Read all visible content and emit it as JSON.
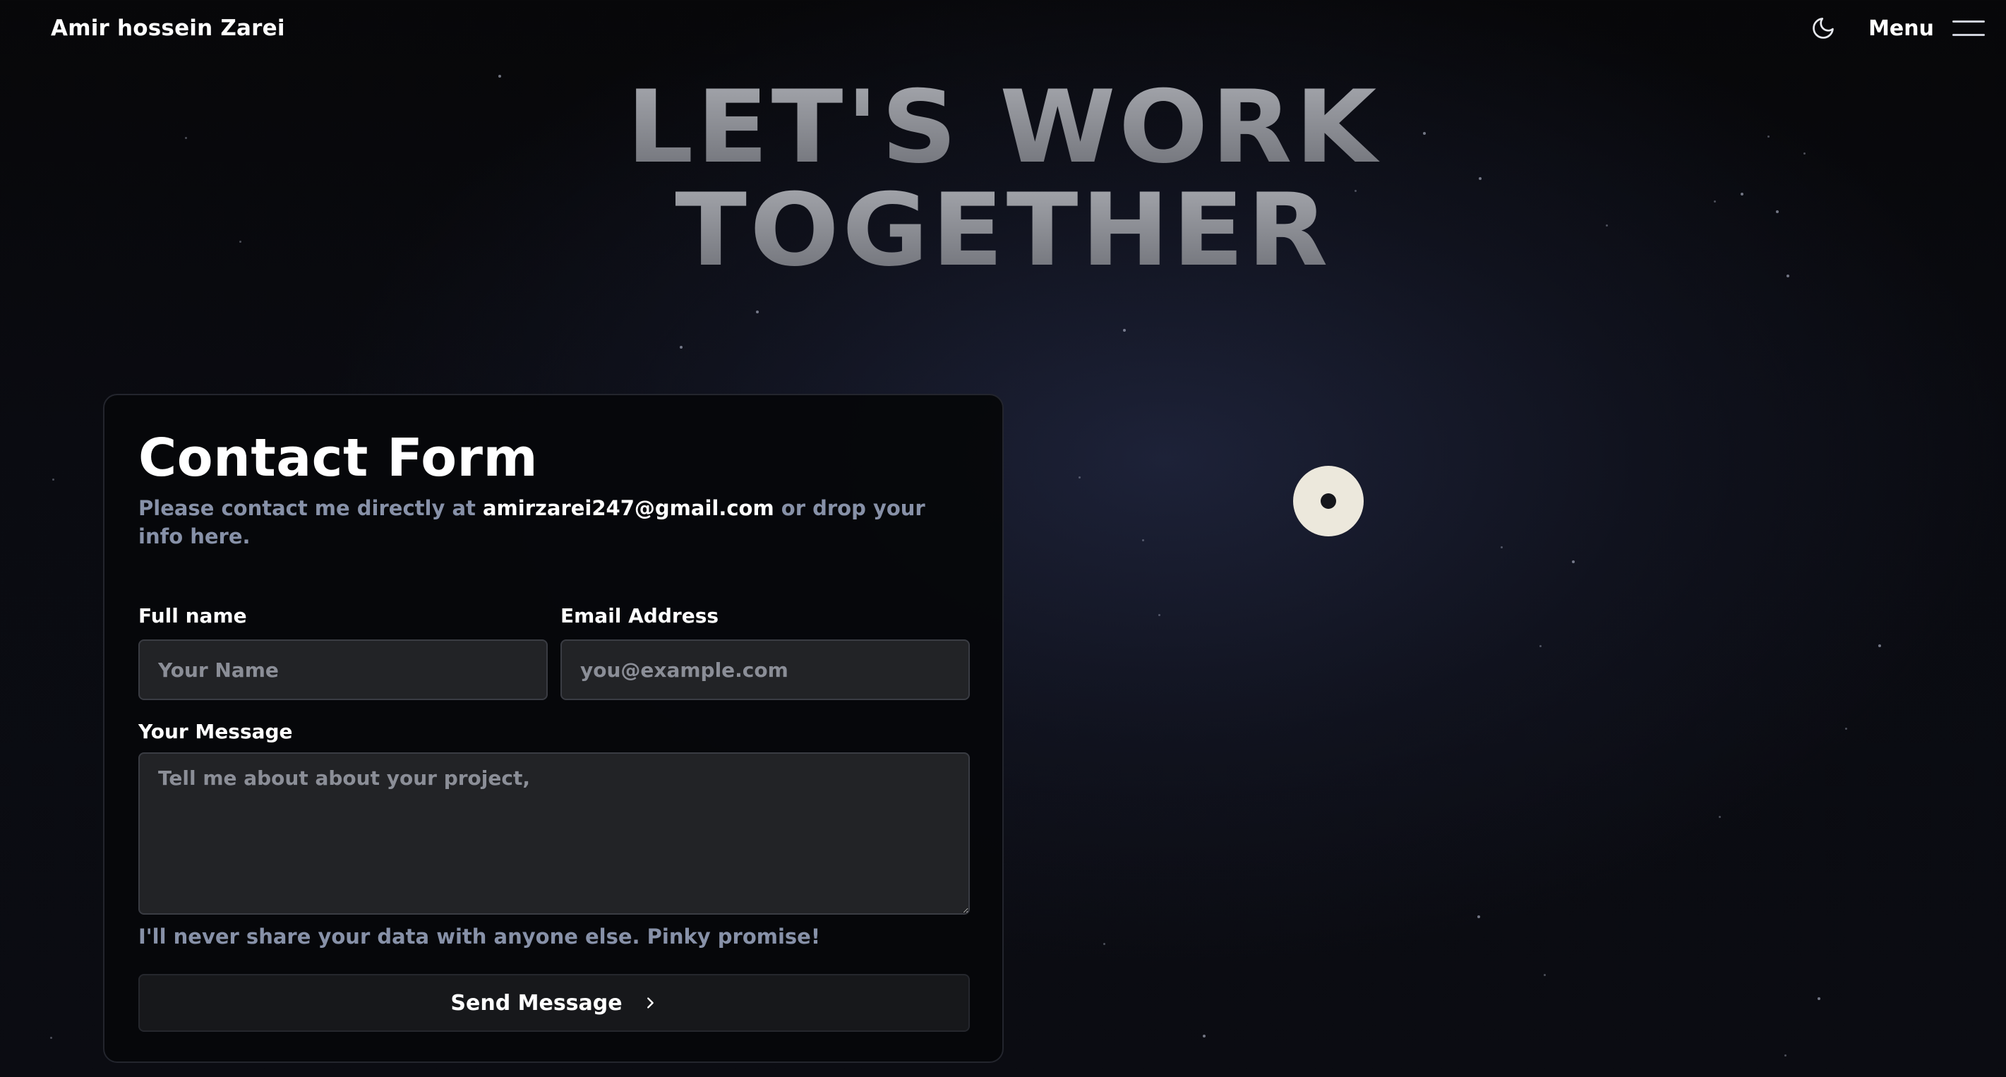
{
  "header": {
    "brand": "Amir hossein Zarei",
    "theme_toggle_icon": "moon-icon",
    "menu_label": "Menu",
    "menu_icon": "hamburger-icon"
  },
  "hero": {
    "line1": "LET'S WORK",
    "line2": "TOGETHER"
  },
  "form": {
    "title": "Contact Form",
    "intro_before": "Please contact me directly at ",
    "intro_email": "amirzarei247@gmail.com",
    "intro_after": " or drop your info here.",
    "fields": {
      "name_label": "Full name",
      "name_placeholder": "Your Name",
      "email_label": "Email Address",
      "email_placeholder": "you@example.com",
      "message_label": "Your Message",
      "message_placeholder": "Tell me about about your project,"
    },
    "privacy_note": "I'll never share your data with anyone else. Pinky promise!",
    "submit_label": "Send Message",
    "submit_icon": "chevron-right-icon"
  },
  "colors": {
    "background": "#0a0b11",
    "card_background": "#06070a",
    "muted_text": "#8791a8",
    "input_background": "#222326",
    "hero_text": "#8a8c92",
    "cursor_ring": "#ece8dc"
  }
}
